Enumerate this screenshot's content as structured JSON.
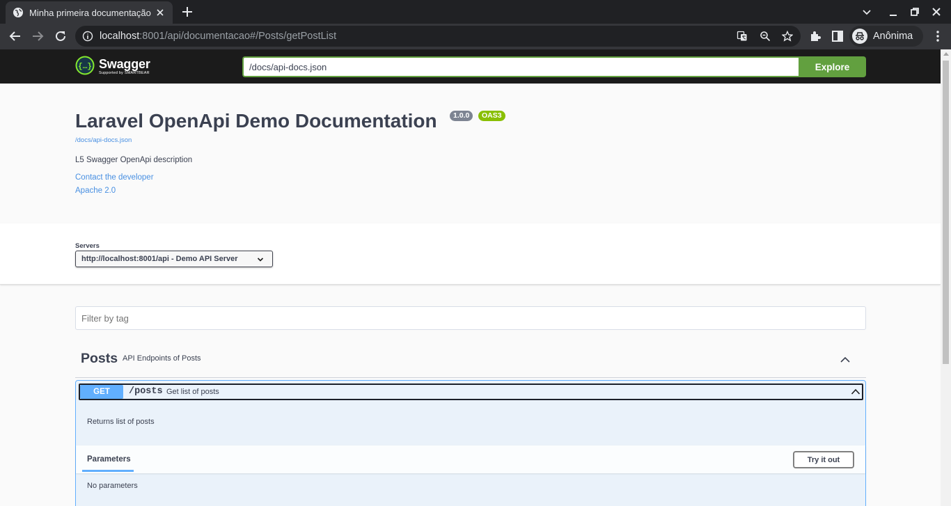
{
  "browser": {
    "tab_title": "Minha primeira documentação",
    "url_host": "localhost",
    "url_rest": ":8001/api/documentacao#/Posts/getPostList",
    "profile_name": "Anônima"
  },
  "swagger_topbar": {
    "logo_text": "Swagger",
    "logo_sub": "Supported by SMARTBEAR",
    "url_value": "/docs/api-docs.json",
    "explore_label": "Explore"
  },
  "info": {
    "title": "Laravel OpenApi Demo Documentation",
    "version_badge": "1.0.0",
    "oas_badge": "OAS3",
    "spec_url": "/docs/api-docs.json",
    "description": "L5 Swagger OpenApi description",
    "contact_link": "Contact the developer",
    "license_link": "Apache 2.0"
  },
  "servers": {
    "label": "Servers",
    "selected": "http://localhost:8001/api - Demo API Server"
  },
  "filter": {
    "placeholder": "Filter by tag"
  },
  "tag": {
    "name": "Posts",
    "description": "API Endpoints of Posts"
  },
  "operation": {
    "method": "GET",
    "path": "/posts",
    "summary": "Get list of posts",
    "description": "Returns list of posts",
    "parameters_tab": "Parameters",
    "try_button": "Try it out",
    "no_parameters": "No parameters"
  },
  "colors": {
    "swagger_green": "#62a03f",
    "get_blue": "#61affe",
    "oas_green": "#89bf04",
    "link_blue": "#4990e2",
    "text_dark": "#3b4151"
  }
}
